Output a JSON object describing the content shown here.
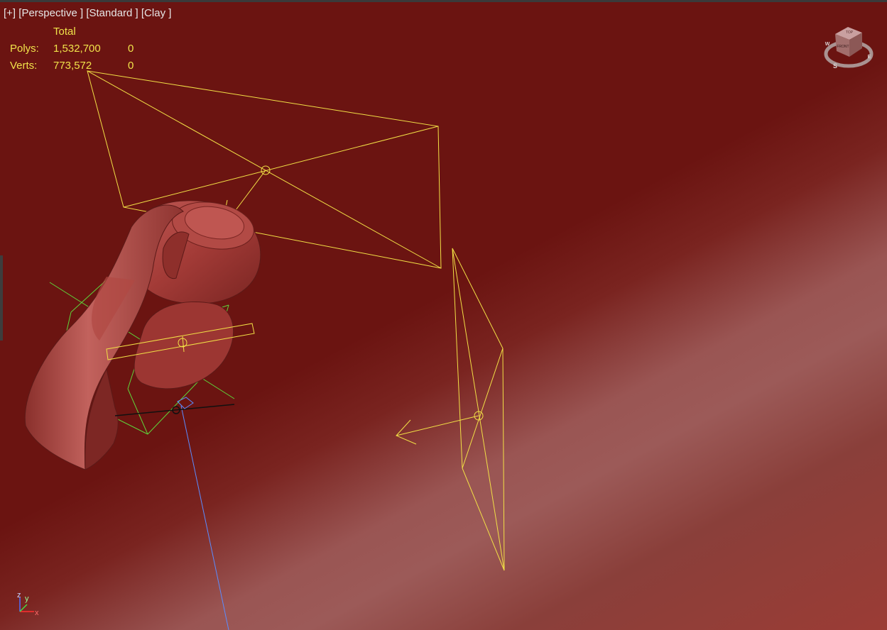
{
  "viewport": {
    "label_plus": "[+]",
    "label_view": "[Perspective ]",
    "label_shading": "[Standard ]",
    "label_style": "[Clay ]"
  },
  "stats": {
    "header": "Total",
    "polys_label": "Polys:",
    "polys_total": "1,532,700",
    "polys_selected": "0",
    "verts_label": "Verts:",
    "verts_total": "773,572",
    "verts_selected": "0"
  },
  "viewcube": {
    "face_top": "TOP",
    "face_front": "FRONT",
    "compass_s": "S",
    "compass_w": "W",
    "compass_e": "E"
  },
  "axis": {
    "z": "z",
    "y": "y",
    "x": "x"
  },
  "colors": {
    "background": "#6b1411",
    "light_gizmo": "#f2e046",
    "helper_green": "#5fd43a",
    "model_clay": "#a8403c",
    "stats_text": "#f0e24a",
    "label_text": "#e6e6e6"
  }
}
